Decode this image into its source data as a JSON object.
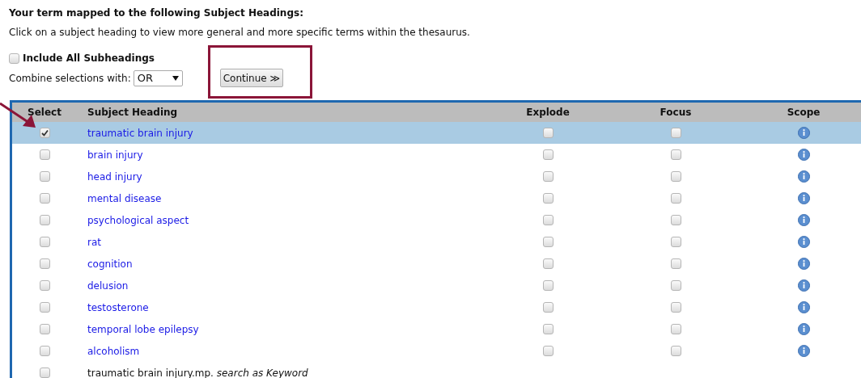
{
  "heading": "Your term mapped to the following Subject Headings:",
  "instructions": "Click on a subject heading to view more general and more specific terms within the thesaurus.",
  "include_all_subheadings": {
    "label": "Include All Subheadings",
    "checked": false
  },
  "combine": {
    "label": "Combine selections with:",
    "value": "OR"
  },
  "continue_button": "Continue ≫",
  "annotations": {
    "highlight_box": true,
    "arrow": true
  },
  "table": {
    "columns": [
      "Select",
      "Subject Heading",
      "Explode",
      "Focus",
      "Scope"
    ],
    "rows": [
      {
        "kind": "heading",
        "term": "traumatic brain injury",
        "selected": true,
        "checked": true,
        "explode": false,
        "focus": false
      },
      {
        "kind": "heading",
        "term": "brain injury",
        "selected": false,
        "checked": false,
        "explode": false,
        "focus": false
      },
      {
        "kind": "heading",
        "term": "head injury",
        "selected": false,
        "checked": false,
        "explode": false,
        "focus": false
      },
      {
        "kind": "heading",
        "term": "mental disease",
        "selected": false,
        "checked": false,
        "explode": false,
        "focus": false
      },
      {
        "kind": "heading",
        "term": "psychological aspect",
        "selected": false,
        "checked": false,
        "explode": false,
        "focus": false
      },
      {
        "kind": "heading",
        "term": "rat",
        "selected": false,
        "checked": false,
        "explode": false,
        "focus": false
      },
      {
        "kind": "heading",
        "term": "cognition",
        "selected": false,
        "checked": false,
        "explode": false,
        "focus": false
      },
      {
        "kind": "heading",
        "term": "delusion",
        "selected": false,
        "checked": false,
        "explode": false,
        "focus": false
      },
      {
        "kind": "heading",
        "term": "testosterone",
        "selected": false,
        "checked": false,
        "explode": false,
        "focus": false
      },
      {
        "kind": "heading",
        "term": "temporal lobe epilepsy",
        "selected": false,
        "checked": false,
        "explode": false,
        "focus": false
      },
      {
        "kind": "heading",
        "term": "alcoholism",
        "selected": false,
        "checked": false,
        "explode": false,
        "focus": false
      },
      {
        "kind": "keyword",
        "term": "traumatic brain injury.mp. *search as Keyword*",
        "selected": false,
        "checked": false
      }
    ]
  }
}
